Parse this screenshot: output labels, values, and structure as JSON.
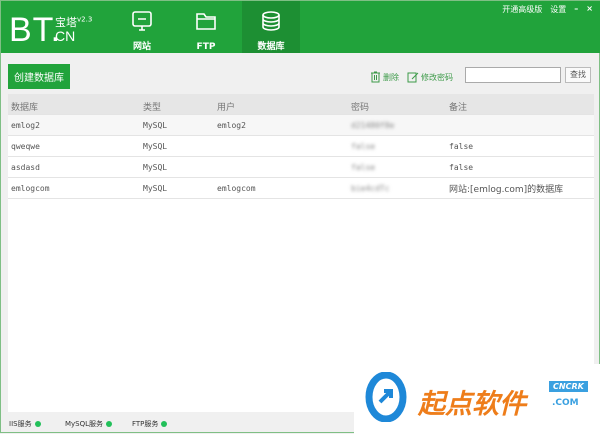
{
  "app": {
    "logo_main": "BT.",
    "logo_cn": "宝塔",
    "version": "v2.3",
    "logo_domain": "CN"
  },
  "nav": [
    {
      "label": "网站",
      "icon": "monitor-icon"
    },
    {
      "label": "FTP",
      "icon": "folder-icon"
    },
    {
      "label": "数据库",
      "icon": "database-icon",
      "active": true
    }
  ],
  "top_links": {
    "upgrade": "开通高级版",
    "settings": "设置",
    "minimize": "–",
    "close": "×"
  },
  "toolbar": {
    "create": "创建数据库",
    "delete": "删除",
    "change_password": "修改密码",
    "search_value": "",
    "search_button": "查找"
  },
  "table": {
    "headers": [
      "数据库",
      "类型",
      "用户",
      "密码",
      "备注"
    ],
    "rows": [
      [
        "emlog2",
        "MySQL",
        "emlog2",
        "d21480f8e",
        ""
      ],
      [
        "qweqwe",
        "MySQL",
        "",
        "false",
        "false"
      ],
      [
        "asdasd",
        "MySQL",
        "",
        "false",
        "false"
      ],
      [
        "emlogcom",
        "MySQL",
        "emlogcom",
        "bie4cdTc",
        "网站:[emlog.com]的数据库"
      ]
    ]
  },
  "status": [
    {
      "label": "IIS服务",
      "running": true
    },
    {
      "label": "MySQL服务",
      "running": true
    },
    {
      "label": "FTP服务",
      "running": true
    }
  ],
  "watermark": {
    "text": "起点软件",
    "badge": "CNCRK",
    "domain": ".COM"
  },
  "colors": {
    "brand": "#21a33b",
    "active_tab": "#1d8f33",
    "status_ok": "#22c05a"
  }
}
